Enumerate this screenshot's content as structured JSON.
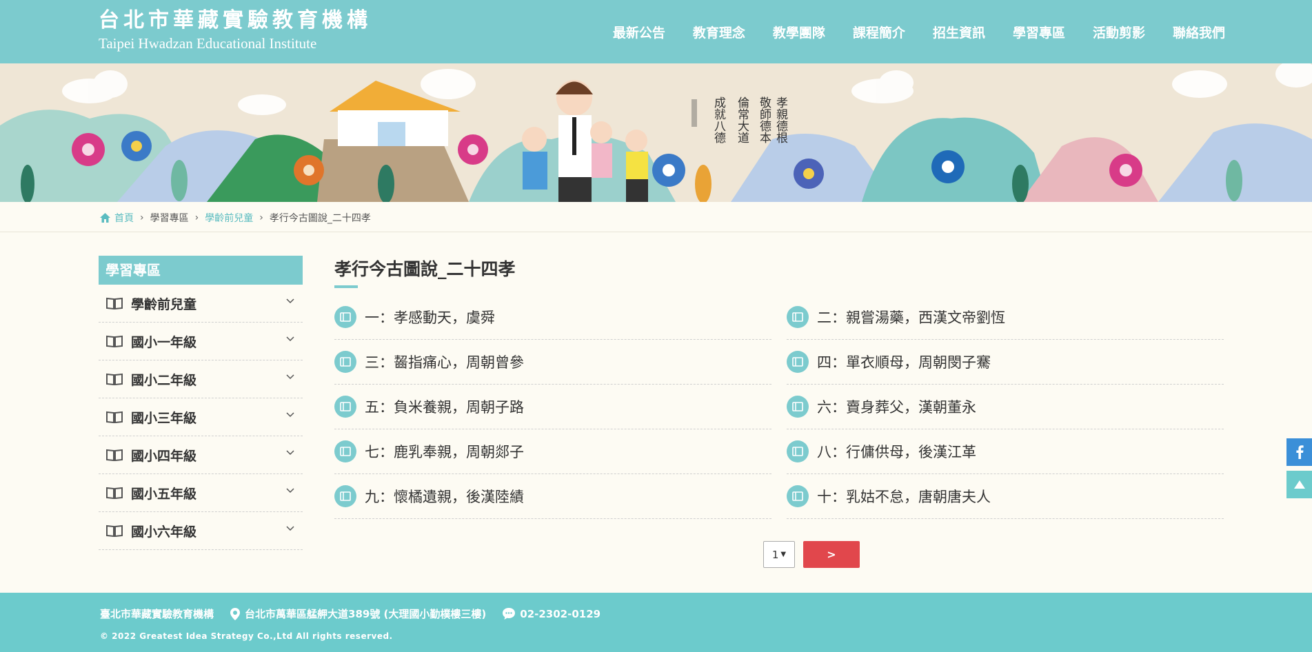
{
  "header": {
    "logo_cn": "台北市華藏實驗教育機構",
    "logo_en": "Taipei Hwadzan Educational Institute",
    "nav": [
      "最新公告",
      "教育理念",
      "教學團隊",
      "課程簡介",
      "招生資訊",
      "學習專區",
      "活動剪影",
      "聯絡我們"
    ]
  },
  "banner": {
    "calligraphy": [
      "孝親德根",
      "敬師德本",
      "倫常大道",
      "成就八德"
    ]
  },
  "breadcrumb": {
    "home": "首頁",
    "level1": "學習專區",
    "level2": "學齡前兒童",
    "current": "孝行今古圖說_二十四孝"
  },
  "sidebar": {
    "title": "學習專區",
    "items": [
      "學齡前兒童",
      "國小一年級",
      "國小二年級",
      "國小三年級",
      "國小四年級",
      "國小五年級",
      "國小六年級"
    ]
  },
  "main": {
    "title": "孝行今古圖說_二十四孝",
    "entries": [
      "一：孝感動天，虞舜",
      "二：親嘗湯藥，西漢文帝劉恆",
      "三：齧指痛心，周朝曾參",
      "四：單衣順母，周朝閔子騫",
      "五：負米養親，周朝子路",
      "六：賣身葬父，漢朝董永",
      "七：鹿乳奉親，周朝郯子",
      "八：行傭供母，後漢江革",
      "九：懷橘遺親，後漢陸績",
      "十：乳姑不怠，唐朝唐夫人"
    ]
  },
  "pager": {
    "page_value": "1",
    "next_label": ">"
  },
  "footer": {
    "org": "臺北市華藏實驗教育機構",
    "address": "台北市萬華區艋舺大道389號 (大理國小勤樸樓三樓)",
    "phone": "02-2302-0129",
    "copyright": "© 2022 Greatest Idea Strategy Co.,Ltd All rights reserved."
  },
  "colors": {
    "teal": "#7ccbce",
    "footer_teal": "#6ccbcc",
    "next_red": "#e1474c",
    "facebook_blue": "#3b8fd8",
    "background": "#fdfbf3"
  }
}
